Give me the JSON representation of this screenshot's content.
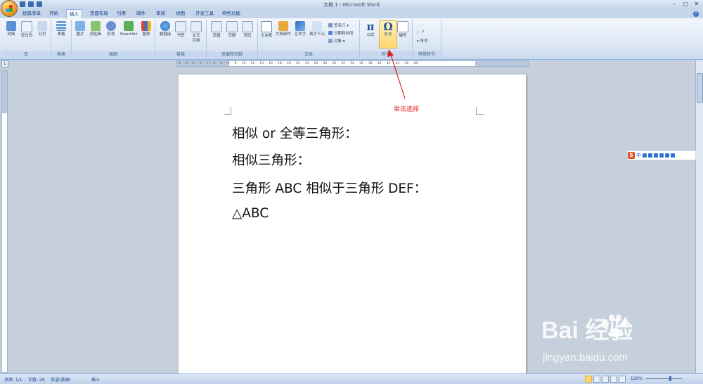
{
  "window": {
    "title": "文档 1 - Microsoft Word"
  },
  "tabs": [
    "经典菜单",
    "开始",
    "插入",
    "页面布局",
    "引用",
    "邮件",
    "审阅",
    "视图",
    "开发工具",
    "特色功能"
  ],
  "active_tab": "插入",
  "ribbon": {
    "pages_group": {
      "label": "页",
      "cover": "封面",
      "blank": "空白页",
      "pagebreak": "分页"
    },
    "tables_group": {
      "label": "表格",
      "table": "表格"
    },
    "illus_group": {
      "label": "插图",
      "picture": "图片",
      "clipart": "剪贴画",
      "shapes": "形状",
      "smartart": "SmartArt",
      "chart": "图表"
    },
    "links_group": {
      "label": "链接",
      "hyperlink": "超链接",
      "bookmark": "书签",
      "crossref1": "交叉",
      "crossref2": "引用"
    },
    "hf_group": {
      "label": "页眉和页脚",
      "header": "页眉",
      "footer": "页脚",
      "pagenum": "页码"
    },
    "text_group": {
      "label": "文本",
      "textbox": "文本框",
      "quickparts": "文档部件",
      "wordart": "艺术字",
      "dropcap": "首字下沉",
      "sigline": "签名行",
      "datetime": "日期和时间",
      "object": "对象"
    },
    "symbols_group": {
      "label": "符号",
      "equation": "公式",
      "equation_glyph": "π",
      "symbol": "符号",
      "symbol_glyph": "Ω",
      "numbering": "编号"
    },
    "special_group": {
      "label": "特殊符号",
      "symbol_small": "符号",
      "dots_row1": "·  ·  ·",
      "dots_row2": "; : ?"
    }
  },
  "ruler_text": "· 8 ·  · 6 ·  · 4 ·  · 2 ·  · L ·  · 2 ·  · 4 ·  · 6 ·  · 8 ·  · 10 ·  · 12 ·  · 14 ·  · 16 ·  · 18 ·  · 20 ·  · 22 ·  · 24 ·  · 26 ·  · 28 ·  · 30 ·  · 32 ·  · 34 ·  · 36 ·  · 38 ·  · 40 ·  · 42 ·  · 44 ·  · 46 ·  · 48 ·",
  "document": {
    "lines": [
      "相似  or  全等三角形：",
      "相似三角形：",
      "三角形 ABC 相似于三角形 DEF：",
      "△ABC"
    ]
  },
  "annotation": {
    "text": "单击选择",
    "color": "#e02020"
  },
  "ime": {
    "label": "中"
  },
  "status": {
    "page": "页面: 1/1",
    "words": "字数: 29",
    "lang": "英语(美国)",
    "mode": "插入",
    "zoom": "120%"
  },
  "watermark": {
    "line1": "Bai  经验",
    "line2": "jingyan.baidu.com"
  },
  "colors": {
    "ribbon_bg": "#dbe6f4",
    "accent": "#15428b",
    "highlight": "#ffd66b"
  }
}
